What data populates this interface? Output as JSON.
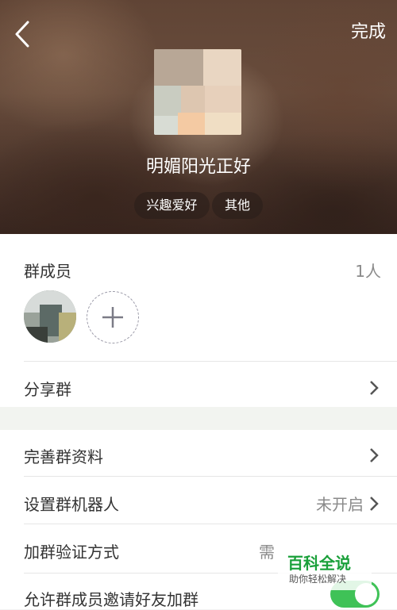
{
  "header": {
    "done_label": "完成",
    "group_name": "明媚阳光正好",
    "tags": [
      "兴趣爱好",
      "其他"
    ]
  },
  "members": {
    "title": "群成员",
    "count": "1人"
  },
  "rows": {
    "share": "分享群",
    "improve_info": "完善群资料",
    "robot": "设置群机器人",
    "robot_status": "未开启",
    "verify": "加群验证方式",
    "verify_value": "需",
    "invite": "允许群成员邀请好友加群"
  },
  "watermark": {
    "title": "百科全说",
    "subtitle": "助你轻松解决"
  },
  "colors": {
    "toggle_on": "#3fc257",
    "watermark_green": "#1aa03a"
  },
  "icons": {
    "back": "back-arrow-icon",
    "add": "plus-icon",
    "chevron": "chevron-right-icon"
  }
}
